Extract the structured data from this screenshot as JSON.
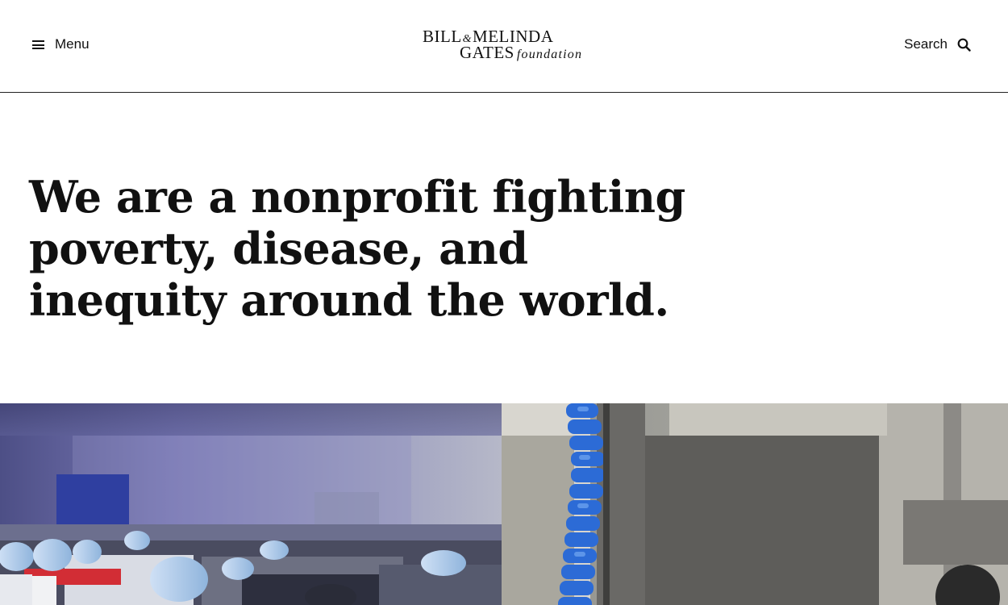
{
  "header": {
    "menu_label": "Menu",
    "logo": {
      "line1_a": "BILL",
      "amp": "&",
      "line1_b": "MELINDA",
      "line2_a": "GATES",
      "line2_b": "foundation"
    },
    "search_label": "Search"
  },
  "hero": {
    "title": "We are a nonprofit fighting poverty, disease, and inequity around the world."
  },
  "icons": {
    "menu": "hamburger-icon",
    "search": "magnifier-icon"
  },
  "colors": {
    "text": "#111111",
    "background": "#ffffff",
    "divider": "#222222"
  }
}
